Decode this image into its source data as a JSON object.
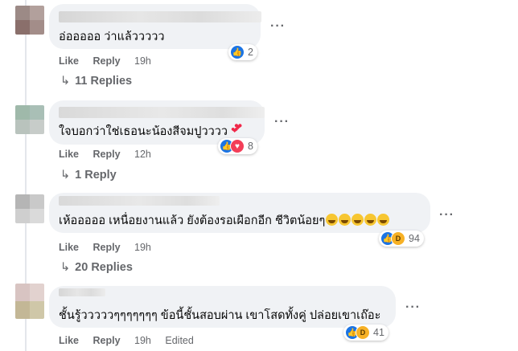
{
  "comments": [
    {
      "text": "อ่อออออ ว่าแล้ววววว",
      "like": "Like",
      "reply": "Reply",
      "time": "19h",
      "reaction_count": "2",
      "reactions": [
        "like"
      ],
      "replies": "11 Replies",
      "more": "···"
    },
    {
      "text": "ใจบอกว่าใช่เธอนะน้องสีจมปูวววว",
      "like": "Like",
      "reply": "Reply",
      "time": "12h",
      "reaction_count": "8",
      "reactions": [
        "like",
        "love"
      ],
      "replies": "1 Reply",
      "more": "···"
    },
    {
      "text": "เห้อออออ เหนื่อยงานแล้ว ยังต้องรอเผือกอีก ชีวิตน้อยๆ",
      "like": "Like",
      "reply": "Reply",
      "time": "19h",
      "reaction_count": "94",
      "reactions": [
        "like",
        "haha"
      ],
      "replies": "20 Replies",
      "more": "···"
    },
    {
      "text": "ชั้นรู้วววววๆๆๆๆๆๆๆ ข้อนี้ชั้นสอบผ่าน เขาโสดทั้งคู่ ปล่อยเขาเถ๊อะ",
      "like": "Like",
      "reply": "Reply",
      "time": "19h",
      "edited": "Edited",
      "reaction_count": "41",
      "reactions": [
        "like",
        "haha"
      ],
      "more": "···"
    }
  ],
  "icons": {
    "reply_arrow": "reply-arrow-icon",
    "more": "more-options-icon",
    "like": "like-reaction-icon",
    "love": "love-reaction-icon",
    "haha": "haha-reaction-icon"
  }
}
